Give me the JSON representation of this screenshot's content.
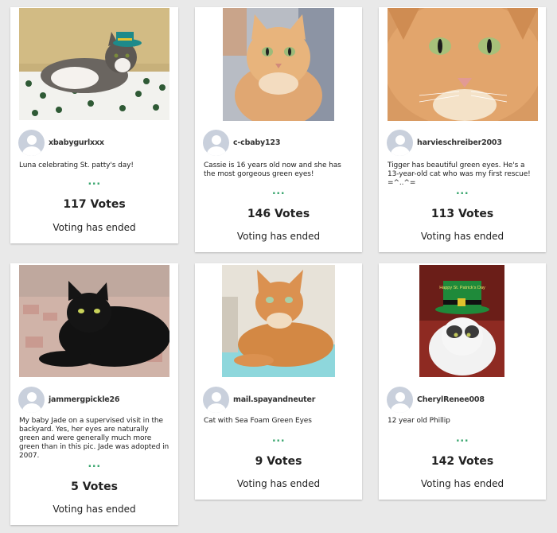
{
  "entries": [
    {
      "username": "xbabygurlxxx",
      "caption": "Luna celebrating St. patty's day!",
      "more": "...",
      "votes": "117 Votes",
      "status": "Voting has ended"
    },
    {
      "username": "c-cbaby123",
      "caption": "Cassie is 16 years old now and she has the most gorgeous green eyes!",
      "more": "...",
      "votes": "146 Votes",
      "status": "Voting has ended"
    },
    {
      "username": "harvieschreiber2003",
      "caption": "Tigger has beautiful green eyes. He's a 13-year-old cat who was my first rescue! =^..^=",
      "more": "...",
      "votes": "113 Votes",
      "status": "Voting has ended"
    },
    {
      "username": "jammergpickle26",
      "caption": "My baby Jade on a supervised visit in the backyard. Yes, her eyes are naturally green and were generally much more green than in this pic. Jade was adopted in 2007.",
      "more": "...",
      "votes": "5 Votes",
      "status": "Voting has ended"
    },
    {
      "username": "mail.spayandneuter",
      "caption": "Cat with Sea Foam Green Eyes",
      "more": "...",
      "votes": "9 Votes",
      "status": "Voting has ended"
    },
    {
      "username": "CherylRenee008",
      "caption": "12 year old Phillip",
      "more": "...",
      "votes": "142 Votes",
      "status": "Voting has ended"
    }
  ],
  "hat_text": "Happy St. Patrick's Day",
  "colors": {
    "accent": "#3aa66f",
    "background": "#e9e9e9",
    "card": "#ffffff",
    "avatar": "#c9d0dc"
  }
}
